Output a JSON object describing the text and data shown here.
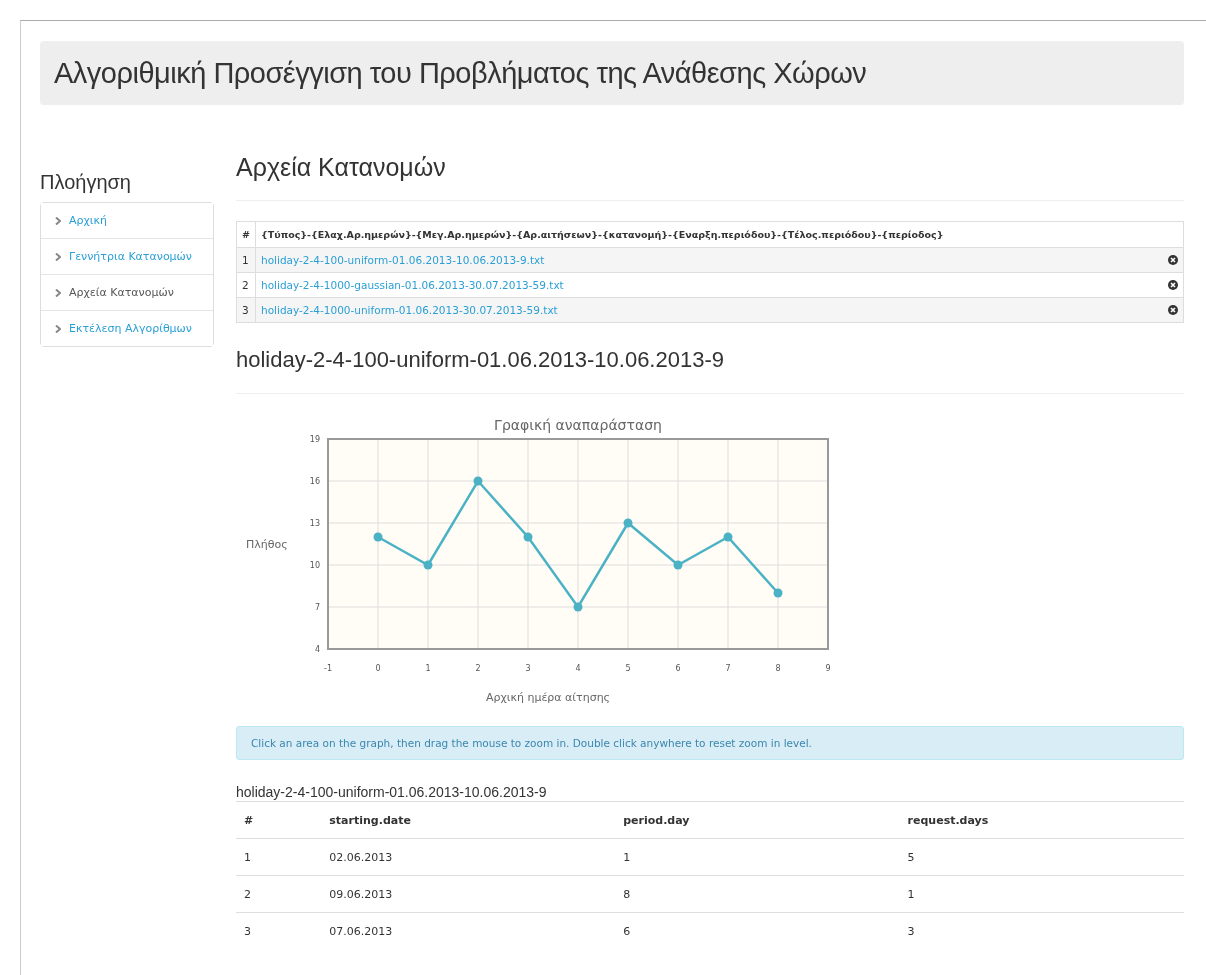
{
  "header": {
    "title": "Αλγοριθμική Προσέγγιση του Προβλήματος της Ανάθεσης Χώρων"
  },
  "sidebar": {
    "title": "Πλοήγηση",
    "items": [
      {
        "label": "Αρχική",
        "selected": false
      },
      {
        "label": "Γεννήτρια Κατανομών",
        "selected": false
      },
      {
        "label": "Αρχεία Κατανομών",
        "selected": true
      },
      {
        "label": "Εκτέλεση Αλγορίθμων",
        "selected": false
      }
    ]
  },
  "page_title": "Αρχεία Κατανομών",
  "files_table": {
    "columns": [
      "#",
      "{Τύπος}-{Ελαχ.Αρ.ημερών}-{Μεγ.Αρ.ημερών}-{Αρ.αιτήσεων}-{κατανομή}-{Εναρξη.περιόδου}-{Τέλος.περιόδου}-{περίοδος}"
    ],
    "rows": [
      {
        "index": "1",
        "file": "holiday-2-4-100-uniform-01.06.2013-10.06.2013-9.txt"
      },
      {
        "index": "2",
        "file": "holiday-2-4-1000-gaussian-01.06.2013-30.07.2013-59.txt"
      },
      {
        "index": "3",
        "file": "holiday-2-4-1000-uniform-01.06.2013-30.07.2013-59.txt"
      }
    ]
  },
  "section_title": "holiday-2-4-100-uniform-01.06.2013-10.06.2013-9",
  "chart": {
    "chart_data": {
      "type": "line",
      "title": "Γραφική αναπαράσταση",
      "xlabel": "Αρχική ημέρα αίτησης",
      "ylabel": "Πλήθος",
      "x": [
        0,
        1,
        2,
        3,
        4,
        5,
        6,
        7,
        8
      ],
      "grid": true,
      "series": [
        {
          "color": "#4bb2c5",
          "marker": true,
          "values": [
            12,
            10,
            16,
            12,
            7,
            13,
            10,
            12,
            8
          ]
        }
      ],
      "xlim": [
        -1,
        9
      ],
      "ylim": [
        4,
        19
      ],
      "xticks": [
        -1,
        0,
        1,
        2,
        3,
        4,
        5,
        6,
        7,
        8,
        9
      ],
      "yticks": [
        4,
        7,
        10,
        13,
        16,
        19
      ]
    }
  },
  "info_alert": "Click an area on the graph, then drag the mouse to zoom in. Double click anywhere to reset zoom in level.",
  "data_table": {
    "caption": "holiday-2-4-100-uniform-01.06.2013-10.06.2013-9",
    "columns": [
      "#",
      "starting.date",
      "period.day",
      "request.days"
    ],
    "rows": [
      [
        "1",
        "02.06.2013",
        "1",
        "5"
      ],
      [
        "2",
        "09.06.2013",
        "8",
        "1"
      ],
      [
        "3",
        "07.06.2013",
        "6",
        "3"
      ]
    ]
  }
}
